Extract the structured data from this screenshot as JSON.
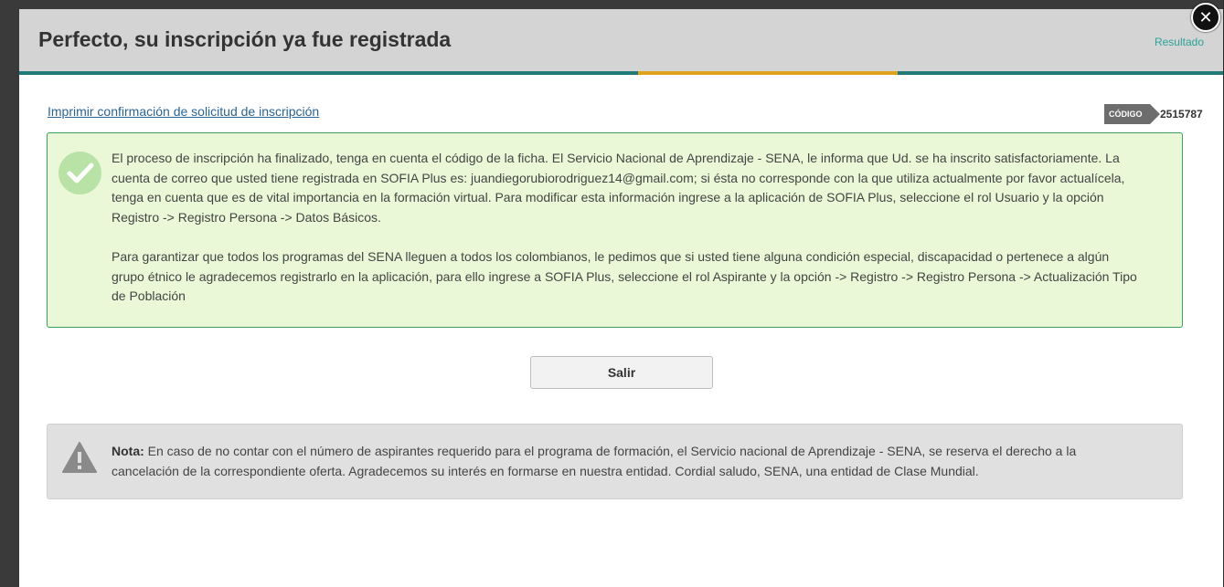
{
  "header": {
    "title": "Perfecto, su inscripción ya fue registrada",
    "step_label": "Resultado",
    "close_symbol": "✕",
    "bar_color": "#1f7a78",
    "accent_color": "#e0a21b"
  },
  "code": {
    "label": "CÓDIGO",
    "value": "2515787"
  },
  "print_link": "Imprimir confirmación de solicitud de inscripción",
  "success": {
    "icon": "check-circle-icon",
    "paragraph1": "El proceso de inscripción ha finalizado, tenga en cuenta el código de la ficha. El Servicio Nacional de Aprendizaje - SENA, le informa que Ud. se ha inscrito satisfactoriamente. La cuenta de correo que usted tiene registrada en SOFIA Plus es: juandiegorubiorodriguez14@gmail.com; si ésta no corresponde con la que utiliza actualmente por favor actualícela, tenga en cuenta que es de vital importancia en la formación virtual. Para modificar esta información ingrese a la aplicación de SOFIA Plus, seleccione el rol Usuario y la opción Registro -> Registro Persona -> Datos Básicos.",
    "paragraph2": "Para garantizar que todos los programas del SENA lleguen a todos los colombianos, le pedimos que si usted tiene alguna condición especial, discapacidad o pertenece a algún grupo étnico le agradecemos registrarlo en la aplicación, para ello ingrese a SOFIA Plus, seleccione el rol Aspirante y la opción -> Registro -> Registro Persona -> Actualización Tipo de Población"
  },
  "exit_button": "Salir",
  "note": {
    "icon": "warning-icon",
    "label": "Nota:",
    "text": " En caso de no contar con el número de aspirantes requerido para el programa de formación, el Servicio nacional de Aprendizaje - SENA, se reserva el derecho a la cancelación de la correspondiente oferta. Agradecemos su interés en formarse en nuestra entidad. Cordial saludo, SENA, una entidad de Clase Mundial."
  }
}
